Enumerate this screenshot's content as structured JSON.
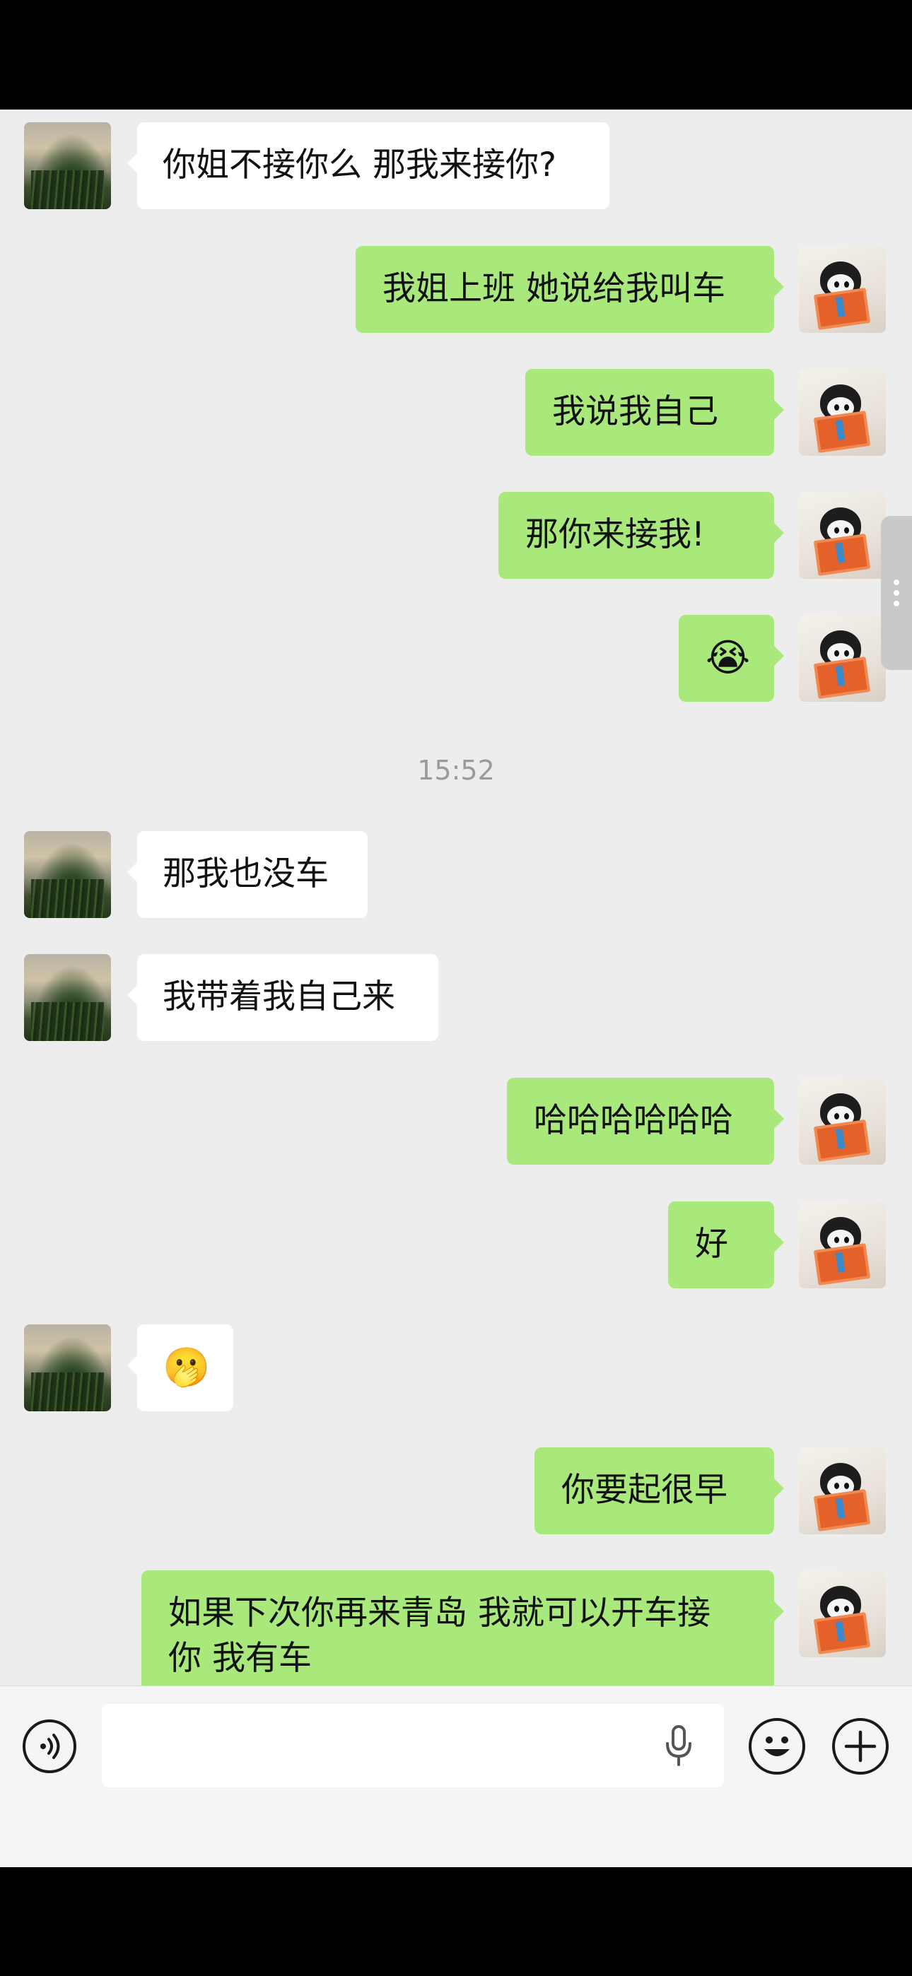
{
  "messages": [
    {
      "side": "left",
      "text": "你姐不接你么 那我来接你?"
    },
    {
      "side": "right",
      "text": "我姐上班 她说给我叫车"
    },
    {
      "side": "right",
      "text": "我说我自己"
    },
    {
      "side": "right",
      "text": "那你来接我!"
    },
    {
      "side": "right",
      "text": "😭"
    },
    {
      "side": "left",
      "text": "那我也没车"
    },
    {
      "side": "left",
      "text": "我带着我自己来"
    },
    {
      "side": "right",
      "text": "哈哈哈哈哈哈"
    },
    {
      "side": "right",
      "text": "好"
    },
    {
      "side": "left",
      "text": "🫢"
    },
    {
      "side": "right",
      "text": "你要起很早"
    },
    {
      "side": "right",
      "line1": "如果下次你再来青岛 我就可以开车接",
      "line2": "你  我有车"
    }
  ],
  "timestamp": "15:52",
  "input_bar": {
    "voice_icon": "voice-icon",
    "mic_icon": "microphone-icon",
    "emoji_icon": "emoji-icon",
    "plus_icon": "plus-icon"
  }
}
